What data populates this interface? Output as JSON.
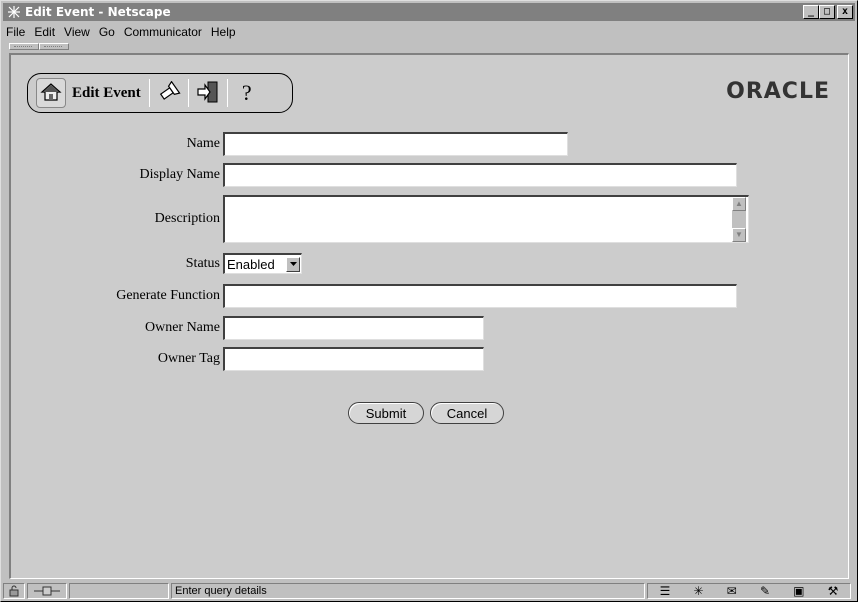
{
  "window": {
    "title": "Edit Event - Netscape",
    "controls": {
      "minimize": "_",
      "maximize": "□",
      "close": "x"
    }
  },
  "menu": [
    {
      "label": "File"
    },
    {
      "label": "Edit"
    },
    {
      "label": "View"
    },
    {
      "label": "Go"
    },
    {
      "label": "Communicator"
    },
    {
      "label": "Help"
    }
  ],
  "toolbar": {
    "title": "Edit Event",
    "icons": [
      "home-icon",
      "flashlight-icon",
      "exit-icon",
      "help-icon"
    ],
    "help_glyph": "?"
  },
  "brand": {
    "logo_text": "ORACLE"
  },
  "form": {
    "name": {
      "label": "Name",
      "value": ""
    },
    "display_name": {
      "label": "Display Name",
      "value": ""
    },
    "description": {
      "label": "Description",
      "value": ""
    },
    "status": {
      "label": "Status",
      "value": "Enabled"
    },
    "generate_function": {
      "label": "Generate Function",
      "value": ""
    },
    "owner_name": {
      "label": "Owner Name",
      "value": ""
    },
    "owner_tag": {
      "label": "Owner Tag",
      "value": ""
    }
  },
  "buttons": {
    "submit": "Submit",
    "cancel": "Cancel"
  },
  "statusbar": {
    "message": "Enter query details",
    "icons": [
      "security-icon",
      "connection-icon",
      "component-icon",
      "netscape-icon",
      "mail-icon",
      "composer-icon",
      "discussion-icon",
      "tools-icon"
    ]
  }
}
